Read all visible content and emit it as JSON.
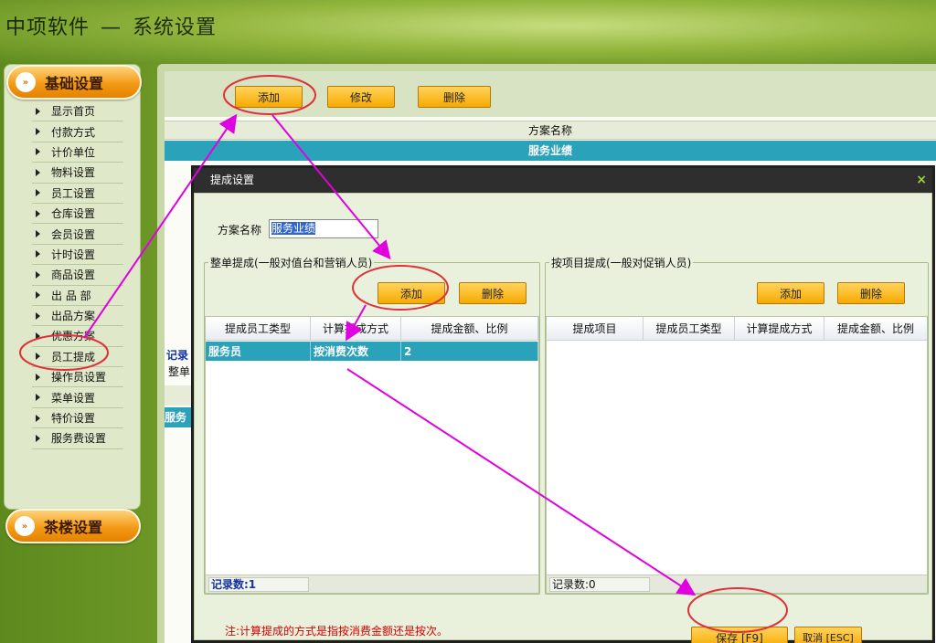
{
  "app": {
    "brand": "中项软件",
    "separator": "—",
    "title": "系统设置"
  },
  "sidebar": {
    "group1": "基础设置",
    "group2": "茶楼设置",
    "items": [
      {
        "label": "显示首页"
      },
      {
        "label": "付款方式"
      },
      {
        "label": "计价单位"
      },
      {
        "label": "物料设置"
      },
      {
        "label": "员工设置"
      },
      {
        "label": "仓库设置"
      },
      {
        "label": "会员设置"
      },
      {
        "label": "计时设置"
      },
      {
        "label": "商品设置"
      },
      {
        "label": "出 品 部"
      },
      {
        "label": "出品方案"
      },
      {
        "label": "优惠方案"
      },
      {
        "label": "员工提成"
      },
      {
        "label": "操作员设置"
      },
      {
        "label": "菜单设置"
      },
      {
        "label": "特价设置"
      },
      {
        "label": "服务费设置"
      }
    ]
  },
  "main": {
    "add": "添加",
    "edit": "修改",
    "delete": "删除",
    "column_header": "方案名称",
    "row": "服务业绩",
    "peek_records": "记录",
    "peek_whole": "整单",
    "peek_service": "服务"
  },
  "dialog": {
    "title": "提成设置",
    "close": "×",
    "scheme_label": "方案名称",
    "scheme_value": "服务业绩",
    "left": {
      "legend": "整单提成(一般对值台和营销人员)",
      "add": "添加",
      "delete": "删除",
      "headers": [
        "提成员工类型",
        "计算提成方式",
        "提成金额、比例"
      ],
      "rows": [
        [
          "服务员",
          "按消费次数",
          "2"
        ]
      ],
      "records": "记录数:1"
    },
    "right": {
      "legend": "按项目提成(一般对促销人员)",
      "add": "添加",
      "delete": "删除",
      "headers": [
        "提成项目",
        "提成员工类型",
        "计算提成方式",
        "提成金额、比例"
      ],
      "records": "记录数:0"
    },
    "note": "注:计算提成的方式是指按消费金额还是按次。",
    "save": "保存 [F9]",
    "cancel": "取消 [ESC]"
  },
  "colors": {
    "accent_orange": "#f7a900",
    "row_highlight": "#2aa2b9",
    "annotation": "#e000e0",
    "circle": "#e0303a"
  }
}
